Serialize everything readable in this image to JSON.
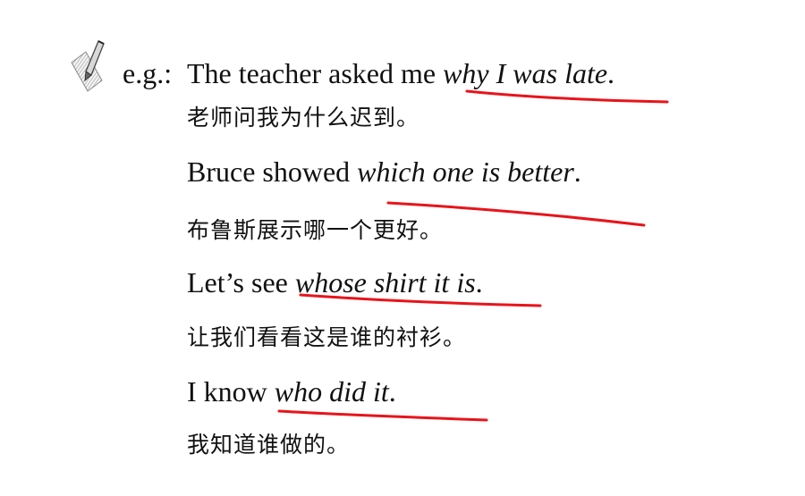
{
  "example": {
    "label": "e.g.:",
    "items": [
      {
        "prefix": "The teacher asked me ",
        "italic": "why I was late",
        "suffix": ".",
        "translation": "老师问我为什么迟到。"
      },
      {
        "prefix": "Bruce showed ",
        "italic": "which one is better",
        "suffix": ".",
        "translation": "布鲁斯展示哪一个更好。"
      },
      {
        "prefix": "Let’s see ",
        "italic": "whose shirt it is",
        "suffix": ".",
        "translation": "让我们看看这是谁的衬衫。"
      },
      {
        "prefix": "I know ",
        "italic": "who did it",
        "suffix": ".",
        "translation": "我知道谁做的。"
      }
    ]
  },
  "icons": {
    "note": "pencil-icon"
  },
  "colors": {
    "underline": "#e8141b",
    "text": "#111111"
  }
}
